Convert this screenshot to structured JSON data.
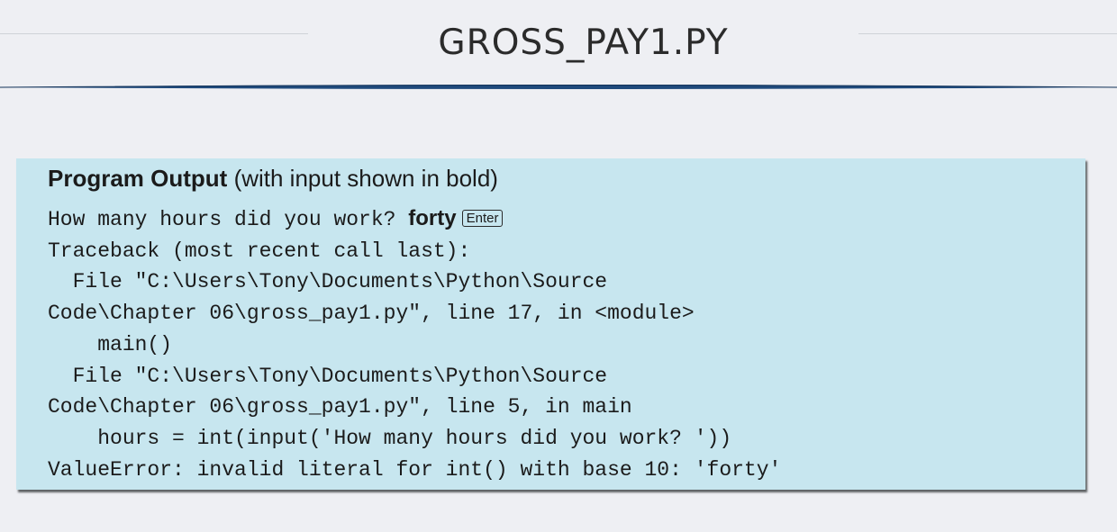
{
  "slide": {
    "title": "GROSS_PAY1.PY"
  },
  "output_box": {
    "heading_bold": "Program Output",
    "heading_rest": " (with input shown in bold)",
    "prompt_text": "How many hours did you work? ",
    "user_input": "forty",
    "enter_key_label": "Enter",
    "lines": [
      "Traceback (most recent call last):",
      "  File \"C:\\Users\\Tony\\Documents\\Python\\Source",
      "Code\\Chapter 06\\gross_pay1.py\", line 17, in <module>",
      "    main()",
      "  File \"C:\\Users\\Tony\\Documents\\Python\\Source",
      "Code\\Chapter 06\\gross_pay1.py\", line 5, in main",
      "    hours = int(input('How many hours did you work? '))",
      "ValueError: invalid literal for int() with base 10: 'forty'"
    ]
  }
}
